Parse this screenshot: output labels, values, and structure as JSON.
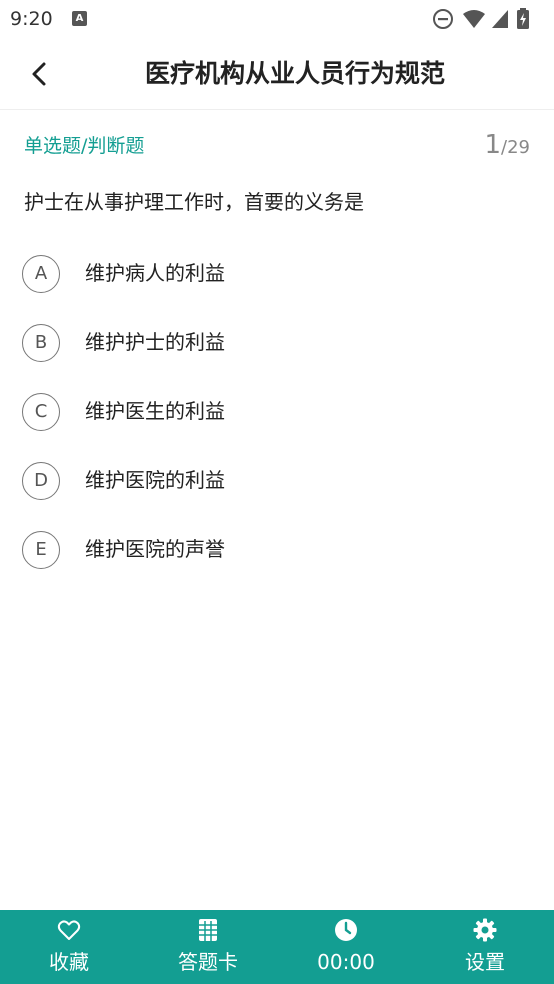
{
  "status_bar": {
    "time": "9:20",
    "notification_icon": "a-icon",
    "icons": [
      "do-not-disturb-icon",
      "wifi-icon",
      "signal-icon",
      "battery-icon"
    ]
  },
  "header": {
    "back_icon": "chevron-left-icon",
    "title": "医疗机构从业人员行为规范"
  },
  "question": {
    "type_label": "单选题/判断题",
    "current": "1",
    "total": "/29",
    "text": "护士在从事护理工作时，首要的义务是",
    "options": [
      {
        "letter": "A",
        "text": "维护病人的利益"
      },
      {
        "letter": "B",
        "text": "维护护士的利益"
      },
      {
        "letter": "C",
        "text": "维护医生的利益"
      },
      {
        "letter": "D",
        "text": "维护医院的利益"
      },
      {
        "letter": "E",
        "text": "维护医院的声誉"
      }
    ]
  },
  "bottom_bar": {
    "color": "#139e92",
    "items": [
      {
        "icon": "heart-icon",
        "label": "收藏"
      },
      {
        "icon": "grid-card-icon",
        "label": "答题卡"
      },
      {
        "icon": "clock-icon",
        "label": "00:00"
      },
      {
        "icon": "gear-icon",
        "label": "设置"
      }
    ]
  },
  "colors": {
    "accent": "#139e92",
    "text": "#222222",
    "muted": "#888888"
  }
}
